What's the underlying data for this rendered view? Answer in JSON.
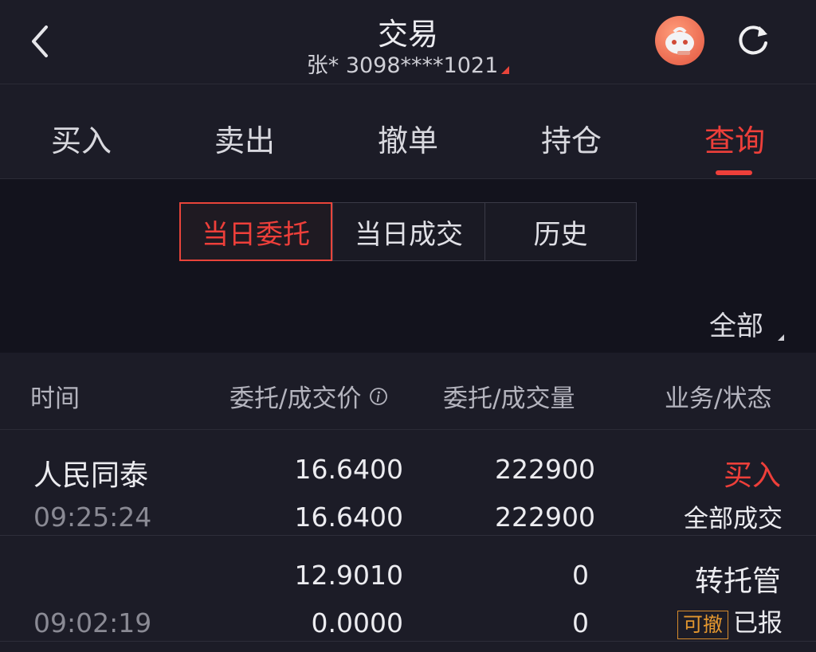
{
  "header": {
    "title": "交易",
    "account": "张* 3098****1021"
  },
  "tabs": [
    {
      "label": "买入"
    },
    {
      "label": "卖出"
    },
    {
      "label": "撤单"
    },
    {
      "label": "持仓"
    },
    {
      "label": "查询"
    }
  ],
  "active_tab": "查询",
  "segments": [
    {
      "label": "当日委托"
    },
    {
      "label": "当日成交"
    },
    {
      "label": "历史"
    }
  ],
  "active_segment": "当日委托",
  "filter": {
    "label": "全部"
  },
  "table": {
    "headers": {
      "time": "时间",
      "price": "委托/成交价",
      "qty": "委托/成交量",
      "status": "业务/状态"
    },
    "rows": [
      {
        "name": "人民同泰",
        "time": "09:25:24",
        "order_price": "16.6400",
        "deal_price": "16.6400",
        "order_qty": "222900",
        "deal_qty": "222900",
        "business": "买入",
        "status": "全部成交"
      },
      {
        "name": "",
        "time": "09:02:19",
        "order_price": "12.9010",
        "deal_price": "0.0000",
        "order_qty": "0",
        "deal_qty": "0",
        "business": "转托管",
        "badge": "可撤",
        "status": "已报"
      }
    ]
  },
  "colors": {
    "accent": "#ee3f3a",
    "background": "#13131d",
    "panel": "#1c1c27",
    "badge": "#e2962f"
  }
}
